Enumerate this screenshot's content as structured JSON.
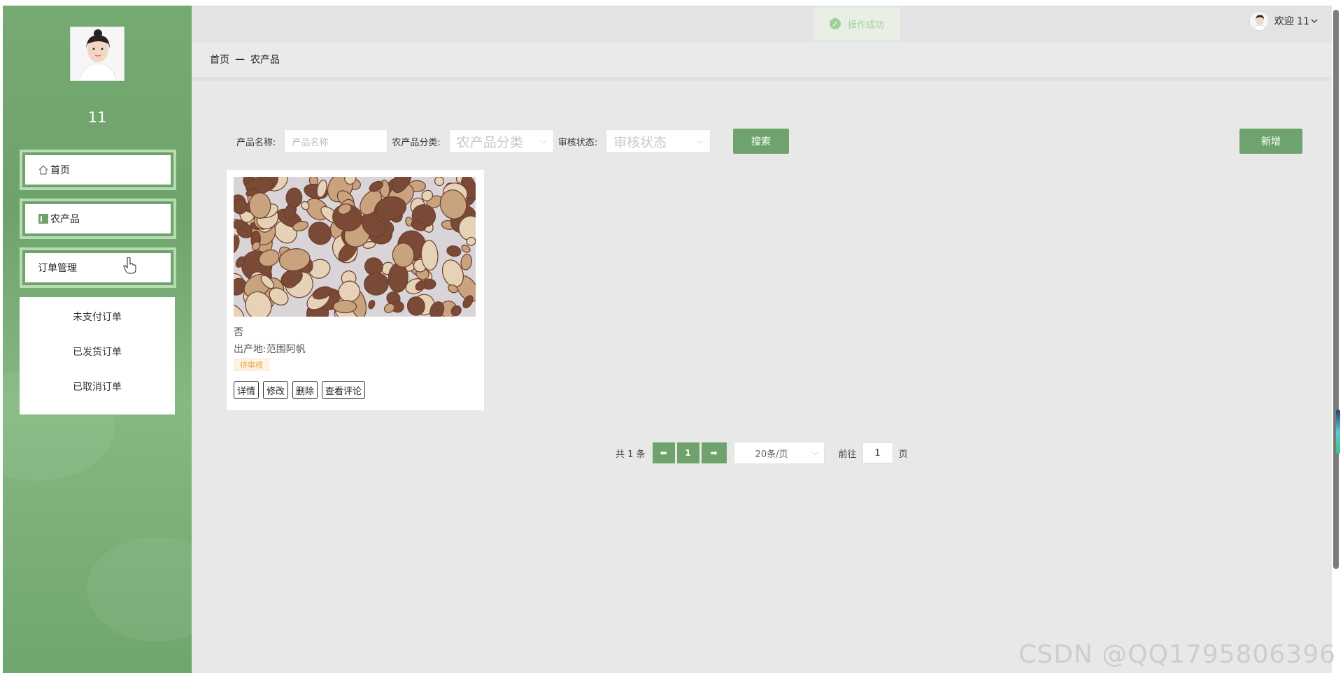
{
  "sidebar": {
    "username": "11",
    "menu": [
      {
        "label": "首页",
        "icon": "home-icon"
      },
      {
        "label": "农产品",
        "icon": "grid-icon"
      },
      {
        "label": "订单管理",
        "icon": ""
      }
    ],
    "submenu": [
      "未支付订单",
      "已发货订单",
      "已取消订单"
    ]
  },
  "header": {
    "toast": "操作成功",
    "welcome": "欢迎 11"
  },
  "breadcrumb": {
    "home": "首页",
    "separator": "—",
    "current": "农产品"
  },
  "search": {
    "name_label": "产品名称:",
    "name_placeholder": "产品名称",
    "category_label": "农产品分类:",
    "category_placeholder": "农产品分类",
    "status_label": "审核状态:",
    "status_placeholder": "审核状态",
    "search_button": "搜索",
    "add_button": "新增"
  },
  "products": [
    {
      "title": "否",
      "origin": "出产地:范围阿帆",
      "status_badge": "待审核",
      "actions": [
        "详情",
        "修改",
        "删除",
        "查看评论"
      ]
    }
  ],
  "pagination": {
    "total": "共 1 条",
    "prev": "⬅",
    "current_page": "1",
    "next": "➡",
    "page_size": "20条/页",
    "goto_label": "前往",
    "goto_value": "1",
    "page_suffix": "页"
  },
  "watermark": "CSDN @QQ1795806396",
  "colors": {
    "primary_green": "#6fa36d",
    "sidebar_green": "#76aa73",
    "badge_orange": "#e8a74a"
  }
}
